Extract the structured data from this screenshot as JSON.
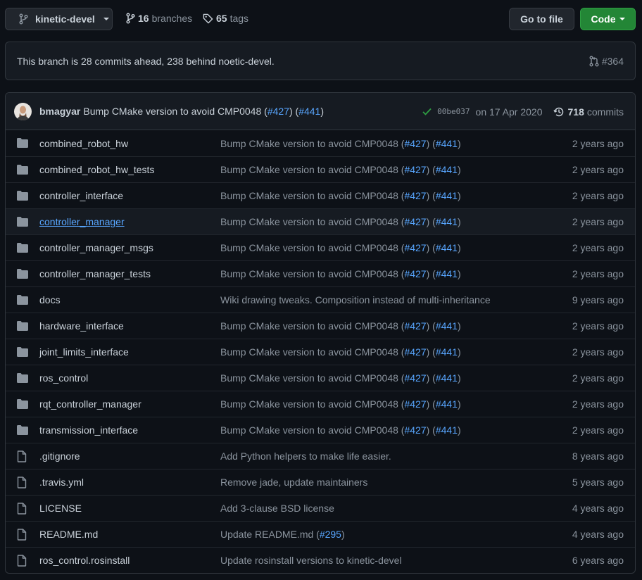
{
  "header": {
    "branch": "kinetic-devel",
    "branches_count": "16",
    "branches_label": "branches",
    "tags_count": "65",
    "tags_label": "tags",
    "go_to_file": "Go to file",
    "code": "Code"
  },
  "branch_status": {
    "message": "This branch is 28 commits ahead, 238 behind noetic-devel.",
    "pr": "#364"
  },
  "latest_commit": {
    "author": "bmagyar",
    "message": "Bump CMake version to avoid CMP0048",
    "pr1": "#427",
    "pr2": "#441",
    "sha": "00be037",
    "date": "on 17 Apr 2020",
    "commits_count": "718",
    "commits_label": "commits"
  },
  "colors": {
    "background": "#0d1117",
    "panel": "#161b22",
    "border": "#30363d",
    "link": "#58a6ff",
    "muted": "#8b949e",
    "success": "#2ea043",
    "code_button": "#238636"
  },
  "files": [
    {
      "type": "folder-icon",
      "name": "combined_robot_hw",
      "msg": "Bump CMake version to avoid CMP0048 (",
      "pr1": "#427",
      "mid": ") (",
      "pr2": "#441",
      "end": ")",
      "age": "2 years ago"
    },
    {
      "type": "folder-icon",
      "name": "combined_robot_hw_tests",
      "msg": "Bump CMake version to avoid CMP0048 (",
      "pr1": "#427",
      "mid": ") (",
      "pr2": "#441",
      "end": ")",
      "age": "2 years ago"
    },
    {
      "type": "folder-icon",
      "name": "controller_interface",
      "msg": "Bump CMake version to avoid CMP0048 (",
      "pr1": "#427",
      "mid": ") (",
      "pr2": "#441",
      "end": ")",
      "age": "2 years ago"
    },
    {
      "type": "folder-icon",
      "name": "controller_manager",
      "msg": "Bump CMake version to avoid CMP0048 (",
      "pr1": "#427",
      "mid": ") (",
      "pr2": "#441",
      "end": ")",
      "age": "2 years ago",
      "hover": true
    },
    {
      "type": "folder-icon",
      "name": "controller_manager_msgs",
      "msg": "Bump CMake version to avoid CMP0048 (",
      "pr1": "#427",
      "mid": ") (",
      "pr2": "#441",
      "end": ")",
      "age": "2 years ago"
    },
    {
      "type": "folder-icon",
      "name": "controller_manager_tests",
      "msg": "Bump CMake version to avoid CMP0048 (",
      "pr1": "#427",
      "mid": ") (",
      "pr2": "#441",
      "end": ")",
      "age": "2 years ago"
    },
    {
      "type": "folder-icon",
      "name": "docs",
      "msg": "Wiki drawing tweaks. Composition instead of multi-inheritance",
      "pr1": "",
      "mid": "",
      "pr2": "",
      "end": "",
      "age": "9 years ago"
    },
    {
      "type": "folder-icon",
      "name": "hardware_interface",
      "msg": "Bump CMake version to avoid CMP0048 (",
      "pr1": "#427",
      "mid": ") (",
      "pr2": "#441",
      "end": ")",
      "age": "2 years ago"
    },
    {
      "type": "folder-icon",
      "name": "joint_limits_interface",
      "msg": "Bump CMake version to avoid CMP0048 (",
      "pr1": "#427",
      "mid": ") (",
      "pr2": "#441",
      "end": ")",
      "age": "2 years ago"
    },
    {
      "type": "folder-icon",
      "name": "ros_control",
      "msg": "Bump CMake version to avoid CMP0048 (",
      "pr1": "#427",
      "mid": ") (",
      "pr2": "#441",
      "end": ")",
      "age": "2 years ago"
    },
    {
      "type": "folder-icon",
      "name": "rqt_controller_manager",
      "msg": "Bump CMake version to avoid CMP0048 (",
      "pr1": "#427",
      "mid": ") (",
      "pr2": "#441",
      "end": ")",
      "age": "2 years ago"
    },
    {
      "type": "folder-icon",
      "name": "transmission_interface",
      "msg": "Bump CMake version to avoid CMP0048 (",
      "pr1": "#427",
      "mid": ") (",
      "pr2": "#441",
      "end": ")",
      "age": "2 years ago"
    },
    {
      "type": "file-icon",
      "name": ".gitignore",
      "msg": "Add Python helpers to make life easier.",
      "pr1": "",
      "mid": "",
      "pr2": "",
      "end": "",
      "age": "8 years ago"
    },
    {
      "type": "file-icon",
      "name": ".travis.yml",
      "msg": "Remove jade, update maintainers",
      "pr1": "",
      "mid": "",
      "pr2": "",
      "end": "",
      "age": "5 years ago"
    },
    {
      "type": "file-icon",
      "name": "LICENSE",
      "msg": "Add 3-clause BSD license",
      "pr1": "",
      "mid": "",
      "pr2": "",
      "end": "",
      "age": "4 years ago"
    },
    {
      "type": "file-icon",
      "name": "README.md",
      "msg": "Update README.md (",
      "pr1": "#295",
      "mid": ")",
      "pr2": "",
      "end": "",
      "age": "4 years ago"
    },
    {
      "type": "file-icon",
      "name": "ros_control.rosinstall",
      "msg": "Update rosinstall versions to kinetic-devel",
      "pr1": "",
      "mid": "",
      "pr2": "",
      "end": "",
      "age": "6 years ago"
    }
  ]
}
